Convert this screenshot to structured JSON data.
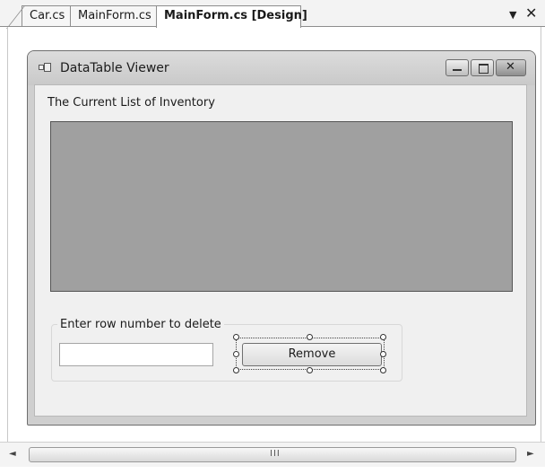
{
  "tabs": [
    {
      "label": "Car.cs",
      "active": false
    },
    {
      "label": "MainForm.cs",
      "active": false
    },
    {
      "label": "MainForm.cs [Design]",
      "active": true
    }
  ],
  "tabstrip": {
    "dropdown_glyph": "▼",
    "close_glyph": "✕"
  },
  "form": {
    "title": "DataTable Viewer",
    "heading": "The Current List of Inventory",
    "group_label": "Enter row number to delete",
    "row_input": {
      "value": "",
      "placeholder": ""
    },
    "remove_label": "Remove"
  },
  "icons": {
    "app": "form-window-icon",
    "minimize": "minimize-icon",
    "maximize": "maximize-icon",
    "close": "close-icon"
  },
  "scrollbar": {
    "left_arrow": "◄",
    "right_arrow": "►",
    "grip": "III"
  },
  "colors": {
    "grid_background": "#a0a0a0",
    "form_background": "#f0f0f0",
    "titlebar": "#cfcfcf"
  }
}
